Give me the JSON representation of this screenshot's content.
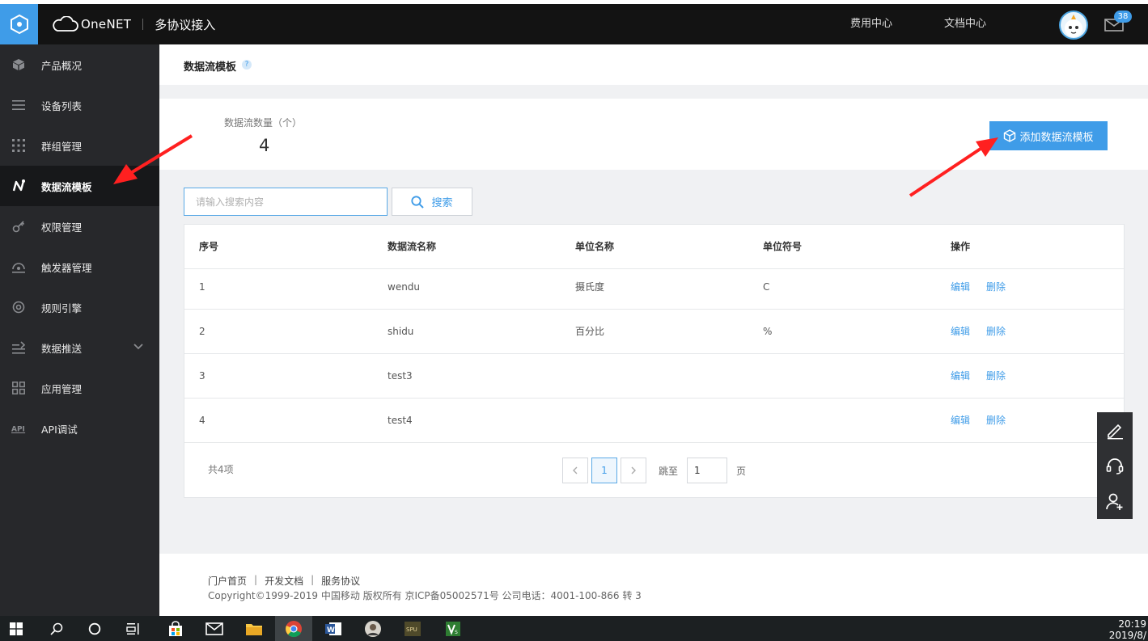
{
  "topbar": {
    "brand_name": "OneNET",
    "brand_sub": "多协议接入",
    "links": [
      "费用中心",
      "文档中心"
    ],
    "mail_badge": "38"
  },
  "sidebar": {
    "items": [
      {
        "label": "产品概况",
        "icon": "cube-icon"
      },
      {
        "label": "设备列表",
        "icon": "list-icon"
      },
      {
        "label": "群组管理",
        "icon": "grid-dots-icon"
      },
      {
        "label": "数据流模板",
        "icon": "datastream-icon",
        "active": true
      },
      {
        "label": "权限管理",
        "icon": "key-icon"
      },
      {
        "label": "触发器管理",
        "icon": "trigger-icon"
      },
      {
        "label": "规则引擎",
        "icon": "rule-engine-icon"
      },
      {
        "label": "数据推送",
        "icon": "push-icon",
        "expandable": true
      },
      {
        "label": "应用管理",
        "icon": "apps-icon"
      },
      {
        "label": "API调试",
        "icon": "api-icon"
      }
    ]
  },
  "page": {
    "title": "数据流模板",
    "help": "?"
  },
  "stats": {
    "label": "数据流数量（个）",
    "value": "4"
  },
  "add_button": "添加数据流模板",
  "search": {
    "placeholder": "请输入搜索内容",
    "button": "搜索"
  },
  "table": {
    "columns": [
      "序号",
      "数据流名称",
      "单位名称",
      "单位符号",
      "操作"
    ],
    "rows": [
      {
        "index": "1",
        "name": "wendu",
        "unit_name": "摄氏度",
        "unit_symbol": "C"
      },
      {
        "index": "2",
        "name": "shidu",
        "unit_name": "百分比",
        "unit_symbol": "%"
      },
      {
        "index": "3",
        "name": "test3",
        "unit_name": "",
        "unit_symbol": ""
      },
      {
        "index": "4",
        "name": "test4",
        "unit_name": "",
        "unit_symbol": ""
      }
    ],
    "edit_label": "编辑",
    "delete_label": "删除"
  },
  "pagination": {
    "total": "共4项",
    "current": "1",
    "jump_label": "跳至",
    "jump_value": "1",
    "page_suffix": "页"
  },
  "footer": {
    "links": [
      "门户首页",
      "开发文档",
      "服务协议"
    ],
    "copyright": "Copyright©1999-2019 中国移动 版权所有 京ICP备05002571号 公司电话：4001-100-866 转 3"
  },
  "taskbar": {
    "time": "20:19",
    "date": "2019/8/"
  },
  "colors": {
    "accent": "#3f9ce8",
    "sidebar_bg": "#27282b",
    "topbar_bg": "#131313",
    "annotation_arrow": "#ff2020"
  }
}
